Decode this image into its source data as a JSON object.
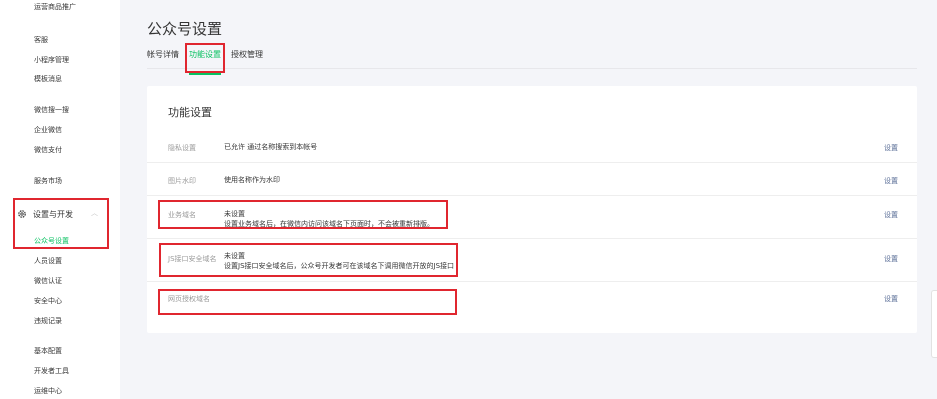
{
  "sidebar": {
    "top_cut": "运营商品推广",
    "items_a": [
      "客服",
      "小程序管理",
      "模板消息"
    ],
    "items_b": [
      "微信搜一搜",
      "企业微信",
      "微信支付"
    ],
    "items_c": [
      "服务市场"
    ],
    "group": {
      "label": "设置与开发"
    },
    "sub_items": [
      "公众号设置",
      "人员设置",
      "微信认证",
      "安全中心",
      "违规记录"
    ],
    "items_d": [
      "基本配置",
      "开发者工具",
      "运维中心"
    ]
  },
  "header": {
    "title": "公众号设置",
    "tabs": [
      {
        "label": "帐号详情"
      },
      {
        "label": "功能设置"
      },
      {
        "label": "授权管理"
      }
    ]
  },
  "card": {
    "title": "功能设置",
    "rows": [
      {
        "label": "隐私设置",
        "line1": "已允许 通过名称搜索到本帐号",
        "line2": "",
        "action": "设置"
      },
      {
        "label": "图片水印",
        "line1": "使用名称作为水印",
        "line2": "",
        "action": "设置"
      },
      {
        "label": "业务域名",
        "line1": "未设置",
        "line2": "设置业务域名后，在微信内访问该域名下页面时，不会被重新排版。",
        "action": "设置"
      },
      {
        "label": "JS接口安全域名",
        "line1": "未设置",
        "line2": "设置JS接口安全域名后，公众号开发者可在该域名下调用微信开放的JS接口",
        "action": "设置"
      },
      {
        "label": "网页授权域名",
        "line1": "",
        "line2": "",
        "action": "设置"
      }
    ]
  },
  "colors": {
    "accent": "#07c160",
    "highlight": "#e0262f",
    "link": "#576b95"
  }
}
